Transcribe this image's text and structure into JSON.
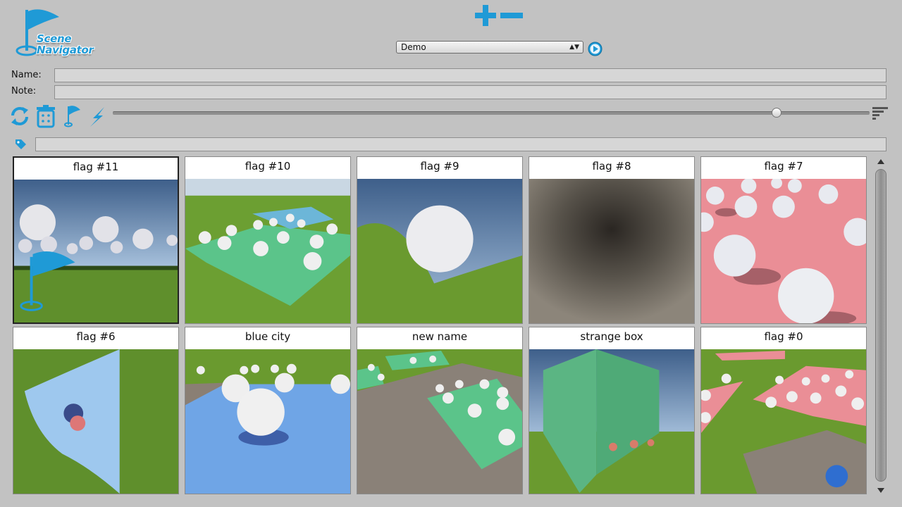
{
  "app": {
    "logo_text_line1": "Scene",
    "logo_text_line2": "Navigator"
  },
  "toolbar_top": {
    "add_icon": "plus-icon",
    "remove_icon": "minus-icon"
  },
  "scene_select": {
    "selected": "Demo",
    "play_icon": "play-icon"
  },
  "fields": {
    "name_label": "Name:",
    "name_value": "",
    "note_label": "Note:",
    "note_value": ""
  },
  "toolbar": {
    "icons": [
      "refresh-icon",
      "trash-icon",
      "flag-icon",
      "lightning-icon",
      "sort-icon"
    ],
    "zoom_slider_level": 0.88
  },
  "filter": {
    "icon": "tag-icon",
    "value": ""
  },
  "cards": [
    {
      "title": "flag #11",
      "selected": true
    },
    {
      "title": "flag #10",
      "selected": false
    },
    {
      "title": "flag #9",
      "selected": false
    },
    {
      "title": "flag #8",
      "selected": false
    },
    {
      "title": "flag #7",
      "selected": false
    },
    {
      "title": "flag #6",
      "selected": false
    },
    {
      "title": "blue city",
      "selected": false
    },
    {
      "title": "new name",
      "selected": false
    },
    {
      "title": "strange box",
      "selected": false
    },
    {
      "title": "flag #0",
      "selected": false
    }
  ],
  "colors": {
    "accent": "#1f9ad6",
    "panel_bg": "#c2c2c2"
  }
}
